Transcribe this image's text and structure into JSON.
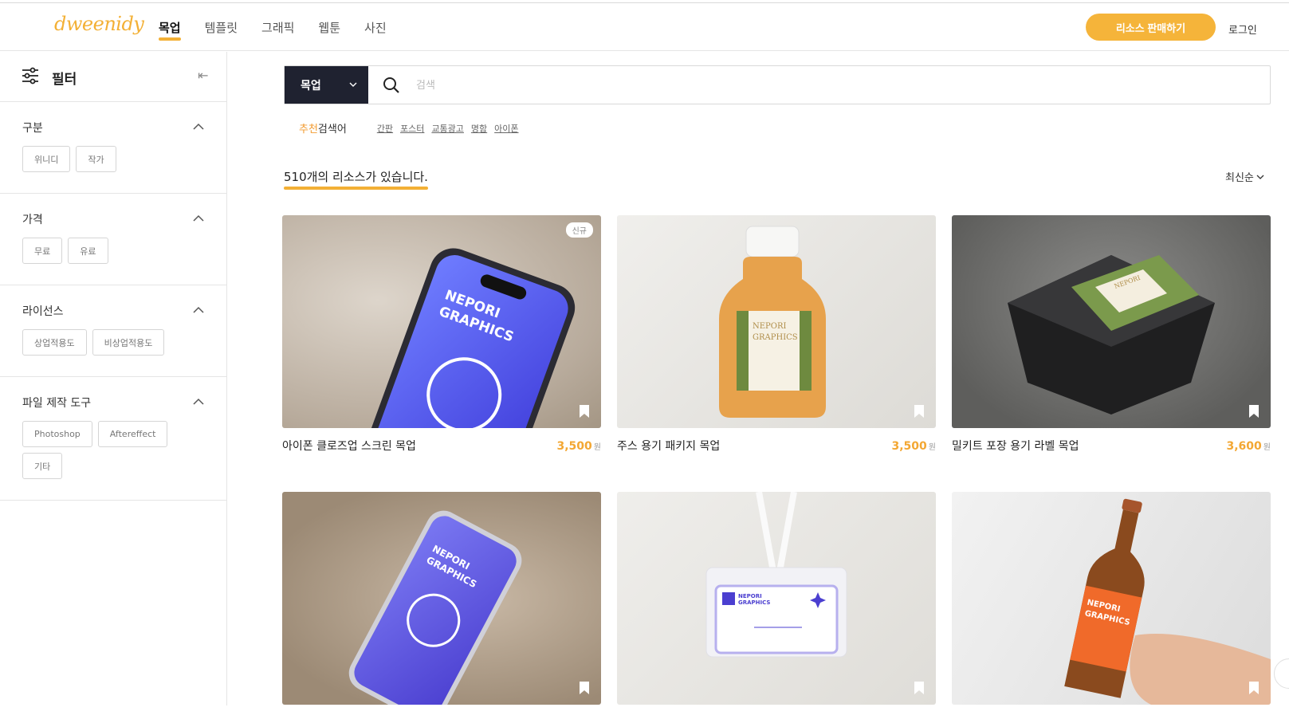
{
  "header": {
    "logo": "dweenidy",
    "nav": [
      "목업",
      "템플릿",
      "그래픽",
      "웹툰",
      "사진"
    ],
    "sell_button": "리소스 판매하기",
    "login": "로그인"
  },
  "filter": {
    "title": "필터",
    "sections": [
      {
        "title": "구분",
        "chips": [
          "위니디",
          "작가"
        ]
      },
      {
        "title": "가격",
        "chips": [
          "무료",
          "유료"
        ]
      },
      {
        "title": "라이선스",
        "chips": [
          "상업적용도",
          "비상업적용도"
        ]
      },
      {
        "title": "파일 제작 도구",
        "chips": [
          "Photoshop",
          "Aftereffect",
          "기타"
        ]
      }
    ]
  },
  "search": {
    "category": "목업",
    "placeholder": "검색",
    "recommend_highlight": "추천",
    "recommend_label": "검색어",
    "tags": [
      "간판",
      "포스터",
      "교통광고",
      "명함",
      "아이폰"
    ]
  },
  "results": {
    "count_text": "510개의 리소스가 있습니다.",
    "sort": "최신순"
  },
  "cards": [
    {
      "title": "아이폰 클로즈업 스크린 목업",
      "price": "3,500",
      "currency": "원",
      "badge": "신규"
    },
    {
      "title": "주스 용기 패키지 목업",
      "price": "3,500",
      "currency": "원",
      "badge": ""
    },
    {
      "title": "밀키트 포장 용기 라벨 목업",
      "price": "3,600",
      "currency": "원",
      "badge": ""
    },
    {
      "title": "",
      "price": "",
      "currency": "",
      "badge": ""
    },
    {
      "title": "",
      "price": "",
      "currency": "",
      "badge": ""
    },
    {
      "title": "",
      "price": "",
      "currency": "",
      "badge": ""
    }
  ],
  "mockup_text": {
    "brand_line1": "NEPORI",
    "brand_line2": "GRAPHICS"
  },
  "colors": {
    "accent": "#f3b035",
    "dark": "#1f2230"
  }
}
